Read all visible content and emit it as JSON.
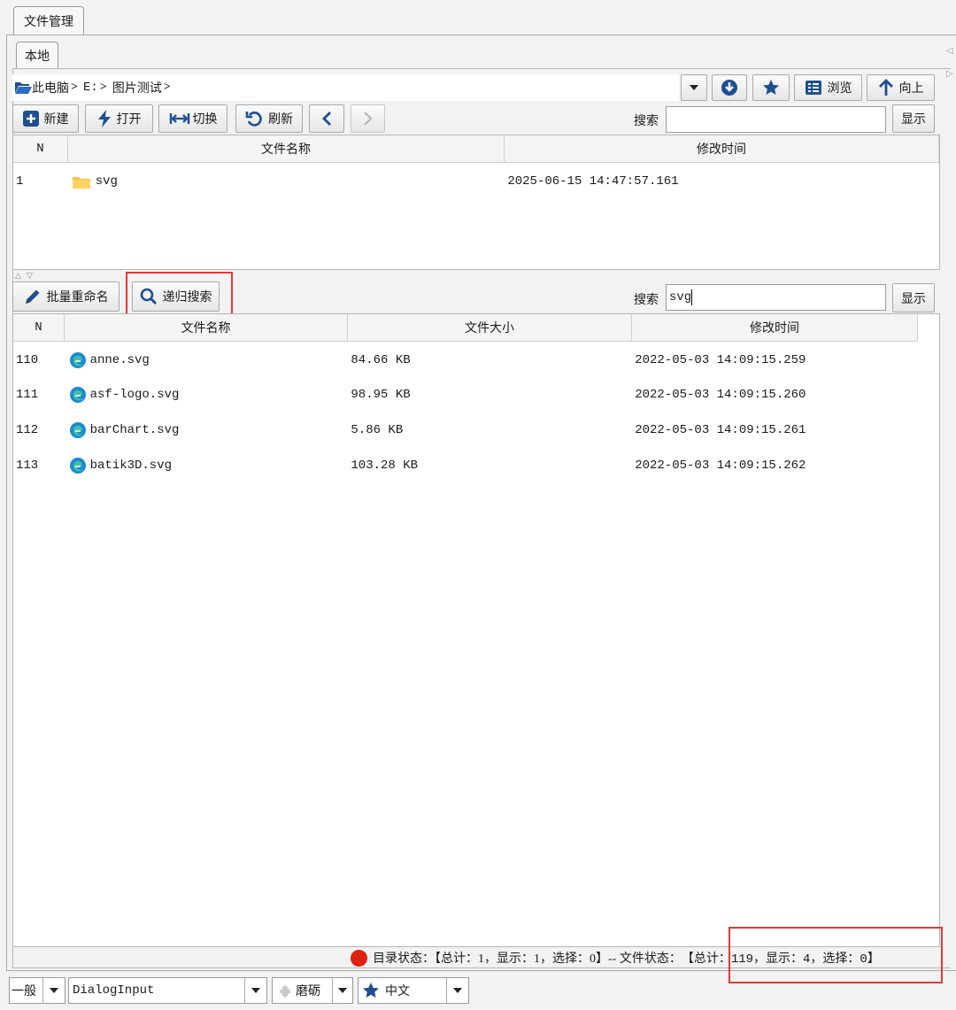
{
  "tabs": {
    "outer": "文件管理",
    "inner": "本地"
  },
  "path": {
    "segments": [
      "此电脑",
      "E:",
      "图片测试"
    ]
  },
  "toolbar_top": {
    "browse_label": "浏览",
    "up_label": "向上"
  },
  "toolbar1": {
    "new_label": "新建",
    "open_label": "打开",
    "switch_label": "切换",
    "refresh_label": "刷新",
    "search_label": "搜索",
    "search_value": "",
    "show_label": "显示"
  },
  "dir_table": {
    "headers": {
      "n": "N",
      "name": "文件名称",
      "mtime": "修改时间"
    },
    "rows": [
      {
        "n": "1",
        "name": "svg",
        "mtime": "2025-06-15 14:47:57.161"
      }
    ]
  },
  "toolbar2": {
    "rename_label": "批量重命名",
    "recursive_label": "递归搜索",
    "search_label": "搜索",
    "search_value": "svg",
    "show_label": "显示"
  },
  "file_table": {
    "headers": {
      "n": "N",
      "name": "文件名称",
      "size": "文件大小",
      "mtime": "修改时间"
    },
    "rows": [
      {
        "n": "110",
        "name": "anne.svg",
        "size": "84.66 KB",
        "mtime": "2022-05-03 14:09:15.259"
      },
      {
        "n": "111",
        "name": "asf-logo.svg",
        "size": "98.95 KB",
        "mtime": "2022-05-03 14:09:15.260"
      },
      {
        "n": "112",
        "name": "barChart.svg",
        "size": "5.86 KB",
        "mtime": "2022-05-03 14:09:15.261"
      },
      {
        "n": "113",
        "name": "batik3D.svg",
        "size": "103.28 KB",
        "mtime": "2022-05-03 14:09:15.262"
      }
    ]
  },
  "status": {
    "dir_status": "目录状态：【总计：1，显示：1，选择：0】-- 文件状态：",
    "file_status": "【总计：119，显示：4，选择：0】"
  },
  "bottom": {
    "category": "一般",
    "font": "DialogInput",
    "theme": "磨砺",
    "language": "中文"
  },
  "colors": {
    "highlight": "#e53935",
    "folder": "#f5c342",
    "edge_icon": "#1a8ad4",
    "status_dot": "#dd2211"
  }
}
